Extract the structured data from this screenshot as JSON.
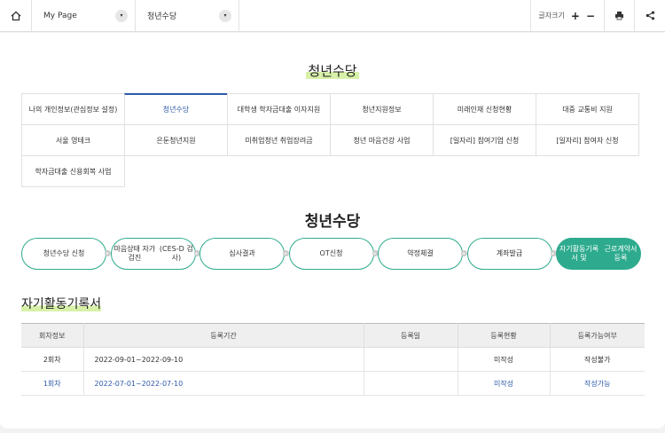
{
  "topbar": {
    "home_icon": "home-icon",
    "breadcrumb1": "My Page",
    "breadcrumb2": "청년수당",
    "dropdown_icon": "▾",
    "font_size_label": "글자크기",
    "plus": "+",
    "minus": "−",
    "print_icon": "print-icon",
    "share_icon": "share-icon"
  },
  "page_title": "청년수당",
  "menu": [
    {
      "label": "나의 개인정보(관심정보 설정)",
      "active": false
    },
    {
      "label": "청년수당",
      "active": true
    },
    {
      "label": "대학생 학자금대출 이자지원",
      "active": false
    },
    {
      "label": "청년지원정보",
      "active": false
    },
    {
      "label": "미래인재 신청현황",
      "active": false
    },
    {
      "label": "대중 교통비 지원",
      "active": false
    },
    {
      "label": "서울 영테크",
      "active": false
    },
    {
      "label": "은둔청년지원",
      "active": false
    },
    {
      "label": "미취업청년 취업장려금",
      "active": false
    },
    {
      "label": "청년 마음건강 사업",
      "active": false
    },
    {
      "label": "[일자리] 참여기업 신청",
      "active": false
    },
    {
      "label": "[일자리] 참여자 신청",
      "active": false
    },
    {
      "label": "학자금대출 신용회복 사업",
      "active": false
    }
  ],
  "section_title": "청년수당",
  "steps": [
    {
      "label": "청년수당 신청",
      "current": false
    },
    {
      "label": "마음상태 자가검진\n(CES-D 검사)",
      "current": false
    },
    {
      "label": "심사결과",
      "current": false
    },
    {
      "label": "OT신청",
      "current": false
    },
    {
      "label": "약정체결",
      "current": false
    },
    {
      "label": "계좌발급",
      "current": false
    },
    {
      "label": "자기활동기록서 및\n근로계약서 등록",
      "current": true
    }
  ],
  "records_title": "자기활동기록서",
  "table": {
    "headers": [
      "회차정보",
      "등록기간",
      "등록일",
      "등록현황",
      "등록가능여부"
    ],
    "rows": [
      {
        "round": "2회차",
        "period": "2022-09-01~2022-09-10",
        "date": "",
        "status": "미작성",
        "available": "작성불가",
        "highlight": false
      },
      {
        "round": "1회차",
        "period": "2022-07-01~2022-07-10",
        "date": "",
        "status": "미작성",
        "available": "작성가능",
        "highlight": true
      }
    ]
  },
  "colors": {
    "accent": "#2eab8e",
    "link": "#2e5aa8",
    "highlight": "#d8f1a8"
  }
}
